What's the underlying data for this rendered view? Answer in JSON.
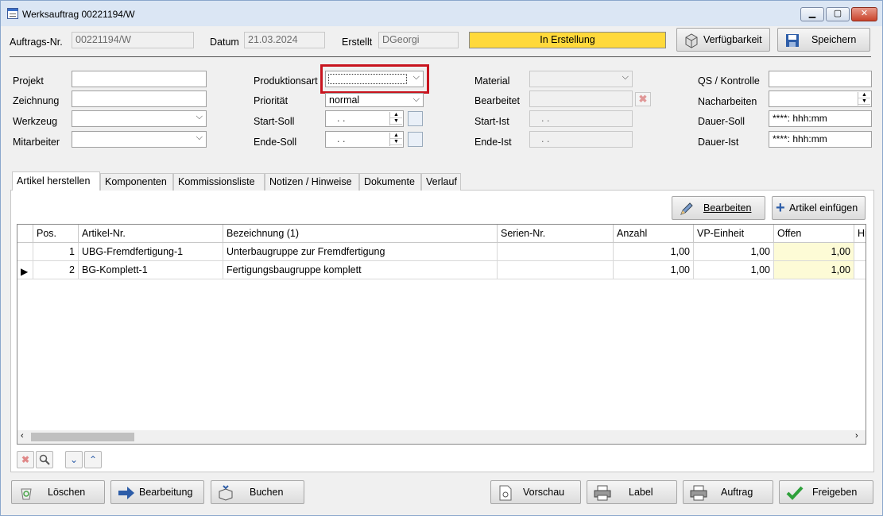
{
  "window": {
    "title": "Werksauftrag 00221194/W",
    "min": "▁",
    "max": "▢",
    "close": "✕"
  },
  "header": {
    "auftrags_label": "Auftrags-Nr.",
    "auftrags_value": "00221194/W",
    "datum_label": "Datum",
    "datum_value": "21.03.2024",
    "erstellt_label": "Erstellt",
    "erstellt_value": "DGeorgi",
    "status": "In Erstellung",
    "verfuegbarkeit": "Verfügbarkeit",
    "speichern": "Speichern"
  },
  "form": {
    "projekt": "Projekt",
    "zeichnung": "Zeichnung",
    "werkzeug": "Werkzeug",
    "mitarbeiter": "Mitarbeiter",
    "produktionsart": "Produktionsart",
    "prioritaet": "Priorität",
    "prioritaet_value": "normal",
    "start_soll": "Start-Soll",
    "ende_soll": "Ende-Soll",
    "date_placeholder": ". .",
    "material": "Material",
    "bearbeitet": "Bearbeitet",
    "start_ist": "Start-Ist",
    "ende_ist": "Ende-Ist",
    "ist_placeholder": ". .",
    "qs": "QS / Kontrolle",
    "nacharbeiten": "Nacharbeiten",
    "dauer_soll": "Dauer-Soll",
    "dauer_ist": "Dauer-Ist",
    "dauer_value": "****:  hhh:mm"
  },
  "tabs": [
    "Artikel herstellen",
    "Komponenten",
    "Kommissionsliste",
    "Notizen / Hinweise",
    "Dokumente",
    "Verlauf"
  ],
  "panel": {
    "bearbeiten": "Bearbeiten",
    "artikel_einfuegen": "Artikel einfügen"
  },
  "table": {
    "columns": [
      "Pos.",
      "Artikel-Nr.",
      "Bezeichnung (1)",
      "Serien-Nr.",
      "Anzahl",
      "VP-Einheit",
      "Offen",
      "Hi"
    ],
    "rows": [
      {
        "pos": "1",
        "artikel": "UBG-Fremdfertigung-1",
        "bez": "Unterbaugruppe zur Fremdfertigung",
        "serie": "",
        "anzahl": "1,00",
        "vp": "1,00",
        "offen": "1,00",
        "marker": ""
      },
      {
        "pos": "2",
        "artikel": "BG-Komplett-1",
        "bez": "Fertigungsbaugruppe komplett",
        "serie": "",
        "anzahl": "1,00",
        "vp": "1,00",
        "offen": "1,00",
        "marker": "▶"
      }
    ]
  },
  "footer": {
    "loeschen": "Löschen",
    "bearbeitung": "Bearbeitung",
    "buchen": "Buchen",
    "vorschau": "Vorschau",
    "label": "Label",
    "auftrag": "Auftrag",
    "freigeben": "Freigeben"
  },
  "colors": {
    "status": "#ffd93b",
    "highlight": "#c8141e",
    "offen_bg": "#fdfbd6"
  }
}
